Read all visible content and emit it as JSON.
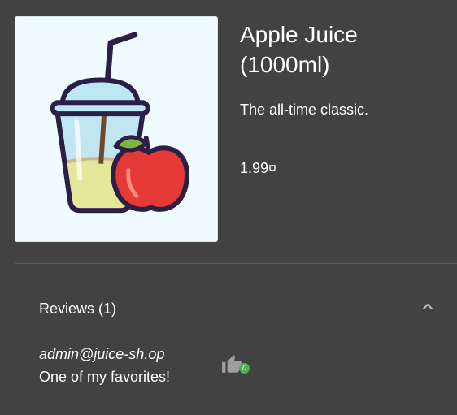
{
  "product": {
    "title": "Apple Juice (1000ml)",
    "description": "The all-time classic.",
    "price": "1.99¤",
    "image_alt": "apple-juice-image"
  },
  "reviews": {
    "title": "Reviews (1)",
    "items": [
      {
        "author": "admin@juice-sh.op",
        "text": "One of my favorites!",
        "likes": "0"
      }
    ]
  },
  "colors": {
    "background": "#424242",
    "image_background": "#f0fbff",
    "like_badge": "#4caf50",
    "apple": "#e53935"
  },
  "icons": {
    "expand": "chevron-up-icon",
    "like": "thumb-up-icon"
  }
}
